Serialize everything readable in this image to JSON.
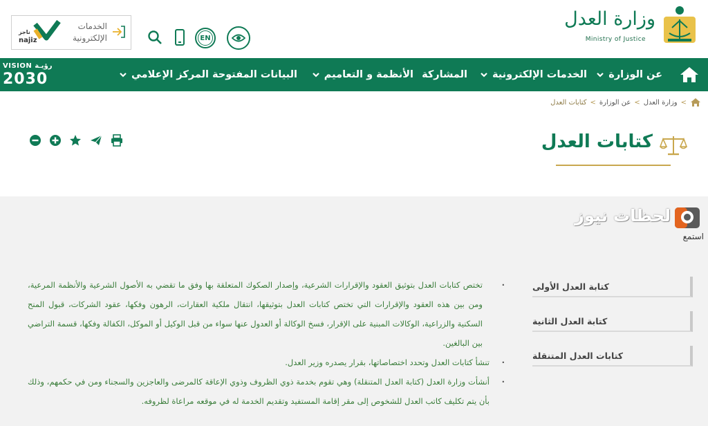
{
  "logo": {
    "arabic": "وزارة العدل",
    "english": "Ministry of Justice"
  },
  "najiz": {
    "line1": "الخدمات",
    "line2": "الإلكترونية",
    "brand": "najiz",
    "brand_ar": "ناجز"
  },
  "header_icons": [
    "search-icon",
    "mobile-icon",
    "language-en-icon",
    "accessibility-eye-icon"
  ],
  "lang_badge": "EN",
  "nav": {
    "items": [
      {
        "label": "عن الوزارة",
        "dropdown": true
      },
      {
        "label": "الخدمات الإلكترونية",
        "dropdown": true
      },
      {
        "label": "المشاركة",
        "dropdown": false
      },
      {
        "label": "الأنظمة و التعاميم",
        "dropdown": true
      },
      {
        "label": "البيانات المفتوحة",
        "dropdown": false
      },
      {
        "label": "المركز الإعلامي",
        "dropdown": true
      }
    ],
    "vision_small": "VISION رؤيـة",
    "vision_year": "2030"
  },
  "breadcrumb": [
    "وزارة العدل",
    "عن الوزارة",
    "كتابات العدل"
  ],
  "page_title": "كتابات العدل",
  "tools": [
    "minus-icon",
    "plus-icon",
    "star-icon",
    "send-icon",
    "print-icon"
  ],
  "watermark": {
    "text": "لحظات نيوز"
  },
  "listen": "استمع",
  "sidebar": [
    {
      "label": "كتابة العدل الأولى"
    },
    {
      "label": "كتابة العدل الثانية"
    },
    {
      "label": "كتابات العدل المتنقلة"
    }
  ],
  "content": {
    "p1": "تختص كتابات العدل بتوثيق العقود والإقرارات الشرعية، وإصدار الصكوك المتعلقة بها وفق ما تقضي به الأصول الشرعية والأنظمة المرعية، ومن بين هذه العقود والإقرارات التي تختص كتابات العدل بتوثيقها، انتقال ملكية العقارات، الرهون وفكها، عقود الشركات، قبول المنح السكنية والزراعية، الوكالات المبنية على الإقرار، فسخ الوكالة أو العدول عنها سواء من قبل الوكيل أو الموكل، الكفالة وفكها، قسمة التراضي بين البالغين.",
    "p2": "تنشأ كتابات العدل وتحدد اختصاصاتها، بقرار يصدره وزير العدل.",
    "p3": "أنشأت وزارة العدل (كتابة العدل المتنقلة) وهي تقوم بخدمة ذوي الظروف وذوي الإعاقة كالمرضى والعاجزين والسجناء ومن في حكمهم، وذلك بأن يتم تكليف كاتب العدل للشخوص إلى مقر إقامة المستفيد وتقديم الخدمة له في موقعه مراعاة لظروفه."
  },
  "colors": {
    "primary": "#0f7a55",
    "gold": "#c9a74e",
    "gray_bg": "#f2f2f2"
  }
}
